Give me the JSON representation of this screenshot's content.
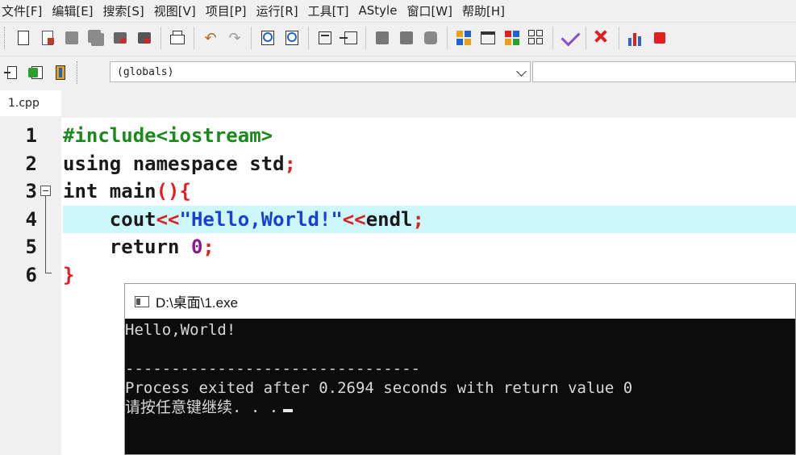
{
  "menu": [
    "文件[F]",
    "编辑[E]",
    "搜索[S]",
    "视图[V]",
    "项目[P]",
    "运行[R]",
    "工具[T]",
    "AStyle",
    "窗口[W]",
    "帮助[H]"
  ],
  "toolbar": {
    "icons": [
      "new-file-icon",
      "open-file-icon",
      "save-icon",
      "save-all-icon",
      "close-icon",
      "close-all-icon",
      "print-icon",
      "undo-icon",
      "redo-icon",
      "find-icon",
      "replace-icon",
      "indent-icon",
      "unindent-icon",
      "toggle-breakpoint-icon",
      "goto-breakpoint-icon",
      "toggle-comment-icon",
      "new-project-icon",
      "window-icon",
      "class-browser-icon",
      "grid-icon",
      "compile-check-icon",
      "stop-icon",
      "chart-icon"
    ]
  },
  "scope_combo": {
    "value": "(globals)"
  },
  "tabs": [
    {
      "label": "1.cpp"
    }
  ],
  "code": {
    "line_numbers": [
      "1",
      "2",
      "3",
      "4",
      "5",
      "6"
    ],
    "highlighted_line": 4,
    "lines": [
      [
        {
          "t": "#include<iostream>",
          "c": "pre"
        }
      ],
      [
        {
          "t": "using namespace std",
          "c": "kw"
        },
        {
          "t": ";",
          "c": "op"
        }
      ],
      [
        {
          "t": "int main",
          "c": "kw"
        },
        {
          "t": "(){",
          "c": "op"
        }
      ],
      [
        {
          "t": "    cout",
          "c": "kw"
        },
        {
          "t": "<<",
          "c": "op"
        },
        {
          "t": "\"Hello,World!\"",
          "c": "str"
        },
        {
          "t": "<<",
          "c": "op"
        },
        {
          "t": "endl",
          "c": "kw"
        },
        {
          "t": ";",
          "c": "op"
        }
      ],
      [
        {
          "t": "    return ",
          "c": "kw"
        },
        {
          "t": "0",
          "c": "num"
        },
        {
          "t": ";",
          "c": "op"
        }
      ],
      [
        {
          "t": "}",
          "c": "op"
        }
      ]
    ]
  },
  "console": {
    "title": "D:\\桌面\\1.exe",
    "lines": [
      "Hello,World!",
      "",
      "--------------------------------",
      "Process exited after 0.2694 seconds with return value 0",
      "请按任意键继续. . ."
    ]
  }
}
